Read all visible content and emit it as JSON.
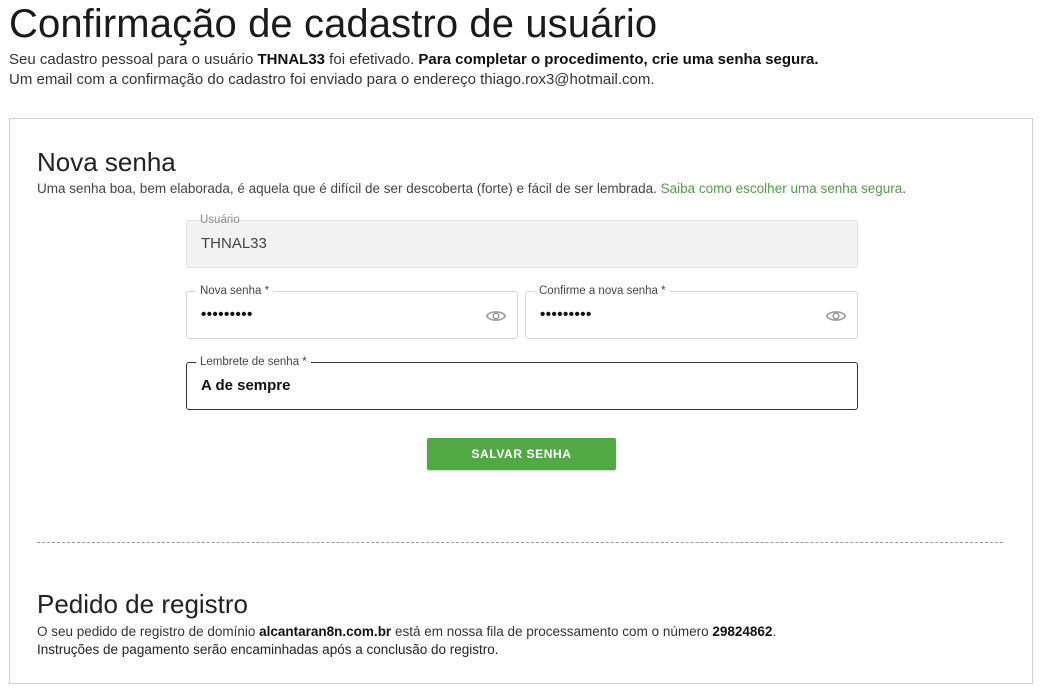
{
  "page": {
    "title": "Confirmação de cadastro de usuário",
    "intro_line1_a": "Seu cadastro pessoal para o usuário ",
    "intro_user": "THNAL33",
    "intro_line1_b": " foi efetivado. ",
    "intro_line1_strong": "Para completar o procedimento, crie uma senha segura.",
    "intro_line2": "Um email com a confirmação do cadastro foi enviado para o endereço thiago.rox3@hotmail.com."
  },
  "password_section": {
    "title": "Nova senha",
    "hint": "Uma senha boa, bem elaborada, é aquela que é difícil de ser descoberta (forte) e fácil de ser lembrada. ",
    "hint_link": "Saiba como escolher uma senha segura",
    "hint_end": ".",
    "fields": {
      "usuario": {
        "label": "Usuário",
        "value": "THNAL33"
      },
      "nova_senha": {
        "label": "Nova senha *",
        "value": "•••••••••"
      },
      "confirma_senha": {
        "label": "Confirme a nova senha *",
        "value": "•••••••••"
      },
      "lembrete": {
        "label": "Lembrete de senha *",
        "value": "A de sempre"
      }
    },
    "save_label": "SALVAR SENHA"
  },
  "order_section": {
    "title": "Pedido de registro",
    "line1_a": "O seu pedido de registro de domínio ",
    "domain": "alcantaran8n.com.br",
    "line1_b": " está em nossa fila de processamento com o número ",
    "number": "29824862",
    "line1_c": ".",
    "line2": "Instruções de pagamento serão encaminhadas após a conclusão do registro."
  },
  "icons": {
    "password_toggle": "eye-icon"
  },
  "colors": {
    "accent_green": "#52a845",
    "link_green": "#4f9e45"
  }
}
